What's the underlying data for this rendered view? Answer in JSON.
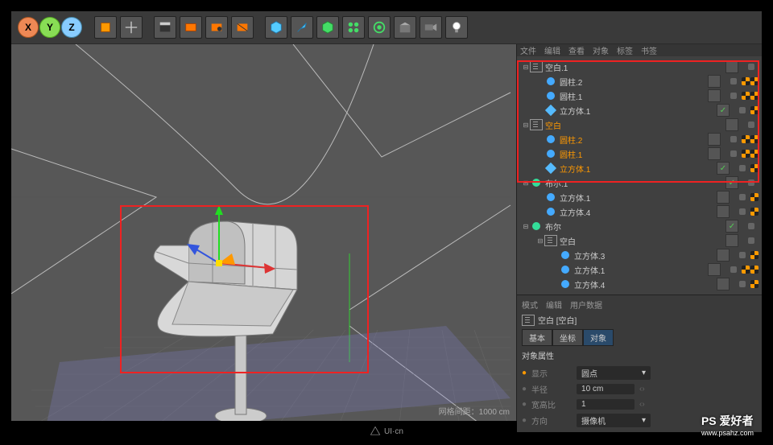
{
  "toolbar": {
    "xyz": {
      "x": "X",
      "y": "Y",
      "z": "Z"
    }
  },
  "viewport": {
    "hud": "网格间距：1000 cm"
  },
  "tabs": {
    "file": "文件",
    "edit": "编辑",
    "view": "查看",
    "object": "对象",
    "label": "标签",
    "book": "书签"
  },
  "tree": [
    {
      "depth": 0,
      "exp": "-",
      "type": "null",
      "label": "空白.1",
      "sel": false,
      "chk": false,
      "tex": []
    },
    {
      "depth": 1,
      "exp": "",
      "type": "obj",
      "label": "圆柱.2",
      "sel": false,
      "chk": false,
      "tex": [
        1,
        1
      ]
    },
    {
      "depth": 1,
      "exp": "",
      "type": "obj",
      "label": "圆柱.1",
      "sel": false,
      "chk": false,
      "tex": [
        1,
        1
      ]
    },
    {
      "depth": 1,
      "exp": "",
      "type": "cube",
      "label": "立方体.1",
      "sel": false,
      "chk": true,
      "tex": [
        1
      ]
    },
    {
      "depth": 0,
      "exp": "-",
      "type": "null",
      "label": "空白",
      "sel": true,
      "chk": false,
      "tex": []
    },
    {
      "depth": 1,
      "exp": "",
      "type": "obj",
      "label": "圆柱.2",
      "sel": true,
      "chk": false,
      "tex": [
        1,
        1
      ]
    },
    {
      "depth": 1,
      "exp": "",
      "type": "obj",
      "label": "圆柱.1",
      "sel": true,
      "chk": false,
      "tex": [
        1,
        1
      ]
    },
    {
      "depth": 1,
      "exp": "",
      "type": "cube",
      "label": "立方体.1",
      "sel": true,
      "chk": true,
      "tex": [
        1
      ]
    },
    {
      "depth": 0,
      "exp": "-",
      "type": "bool",
      "label": "布尔.1",
      "sel": false,
      "chk": true,
      "tex": []
    },
    {
      "depth": 1,
      "exp": "",
      "type": "obj",
      "label": "立方体.1",
      "sel": false,
      "chk": false,
      "tex": [
        1
      ]
    },
    {
      "depth": 1,
      "exp": "",
      "type": "obj",
      "label": "立方体.4",
      "sel": false,
      "chk": false,
      "tex": [
        1
      ]
    },
    {
      "depth": 0,
      "exp": "-",
      "type": "bool",
      "label": "布尔",
      "sel": false,
      "chk": true,
      "tex": []
    },
    {
      "depth": 1,
      "exp": "-",
      "type": "null",
      "label": "空白",
      "sel": false,
      "chk": false,
      "tex": []
    },
    {
      "depth": 2,
      "exp": "",
      "type": "obj",
      "label": "立方体.3",
      "sel": false,
      "chk": false,
      "tex": [
        1
      ]
    },
    {
      "depth": 2,
      "exp": "",
      "type": "obj",
      "label": "立方体.1",
      "sel": false,
      "chk": false,
      "tex": [
        1,
        1
      ]
    },
    {
      "depth": 2,
      "exp": "",
      "type": "obj",
      "label": "立方体.4",
      "sel": false,
      "chk": false,
      "tex": [
        1
      ]
    }
  ],
  "attr": {
    "tabs": {
      "mode": "模式",
      "edit": "编辑",
      "userdata": "用户数据"
    },
    "obj_title": "空白 [空白]",
    "subtabs": {
      "basic": "基本",
      "coord": "坐标",
      "object": "对象"
    },
    "section": "对象属性",
    "rows": {
      "display": {
        "label": "显示",
        "value": "圆点"
      },
      "radius": {
        "label": "半径",
        "value": "10 cm"
      },
      "ratio": {
        "label": "宽高比",
        "value": "1"
      },
      "direction": {
        "label": "方向",
        "value": "摄像机"
      }
    }
  },
  "watermark": {
    "brand": "PS 爱好者",
    "url": "www.psahz.com",
    "footer": "UI·cn"
  }
}
